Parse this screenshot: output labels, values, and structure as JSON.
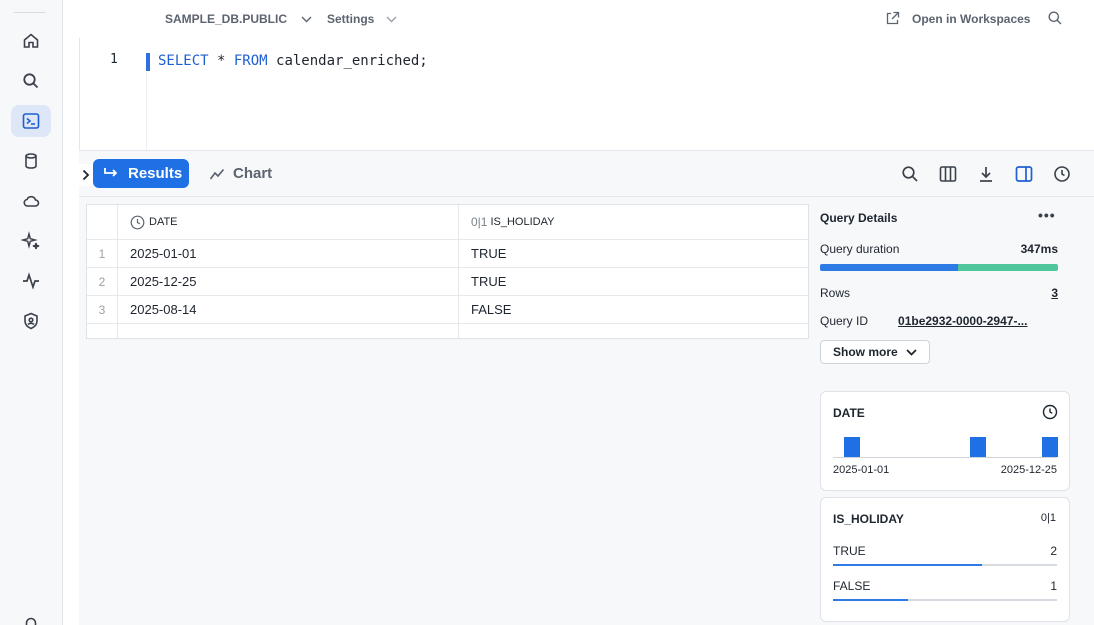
{
  "topbar": {
    "database": "SAMPLE_DB.PUBLIC",
    "settings": "Settings",
    "open_workspaces": "Open in Workspaces"
  },
  "editor": {
    "line_number": "1",
    "code": {
      "kw1": "SELECT",
      "mid": " * ",
      "kw2": "FROM",
      "rest": " calendar_enriched;"
    }
  },
  "results_bar": {
    "results_tab": "Results",
    "chart_tab": "Chart"
  },
  "grid": {
    "columns": [
      {
        "name": "DATE",
        "type_icon": "clock-icon"
      },
      {
        "name": "IS_HOLIDAY",
        "type_icon": "0|1"
      }
    ],
    "rows": [
      {
        "idx": "1",
        "date": "2025-01-01",
        "is_holiday": "TRUE"
      },
      {
        "idx": "2",
        "date": "2025-12-25",
        "is_holiday": "TRUE"
      },
      {
        "idx": "3",
        "date": "2025-08-14",
        "is_holiday": "FALSE"
      }
    ]
  },
  "query_details": {
    "title": "Query Details",
    "duration_label": "Query duration",
    "duration_value": "347ms",
    "duration_split": [
      0.58,
      0.42
    ],
    "rows_label": "Rows",
    "rows_value": "3",
    "query_id_label": "Query ID",
    "query_id_value": "01be2932-0000-2947-...",
    "show_more": "Show more"
  },
  "date_card": {
    "title": "DATE",
    "min_label": "2025-01-01",
    "max_label": "2025-12-25"
  },
  "holiday_card": {
    "title": "IS_HOLIDAY",
    "type_icon": "0|1",
    "items": [
      {
        "label": "TRUE",
        "count": "2",
        "fraction": 0.667
      },
      {
        "label": "FALSE",
        "count": "1",
        "fraction": 0.333
      }
    ]
  },
  "colors": {
    "accent": "#1f6fe5",
    "duration_secondary": "#4fc79a"
  }
}
